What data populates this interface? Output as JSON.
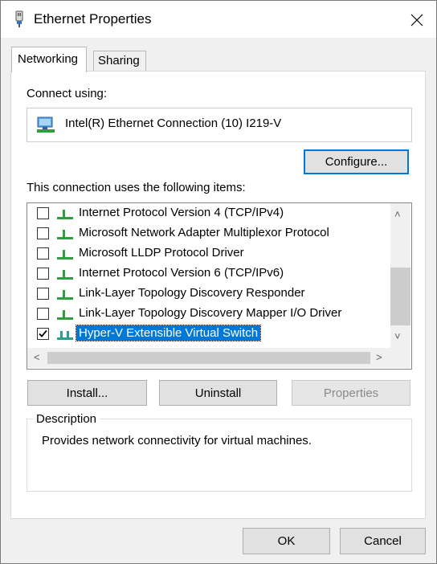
{
  "window": {
    "title": "Ethernet Properties"
  },
  "tabs": [
    {
      "label": "Networking",
      "active": true
    },
    {
      "label": "Sharing",
      "active": false
    }
  ],
  "connect_using": {
    "label": "Connect using:",
    "adapter_name": "Intel(R) Ethernet Connection (10) I219-V",
    "configure_label": "Configure..."
  },
  "items": {
    "heading": "This connection uses the following items:",
    "list": [
      {
        "label": "Internet Protocol Version 4 (TCP/IPv4)",
        "checked": false
      },
      {
        "label": "Microsoft Network Adapter Multiplexor Protocol",
        "checked": false
      },
      {
        "label": "Microsoft LLDP Protocol Driver",
        "checked": false
      },
      {
        "label": "Internet Protocol Version 6 (TCP/IPv6)",
        "checked": false
      },
      {
        "label": "Link-Layer Topology Discovery Responder",
        "checked": false
      },
      {
        "label": "Link-Layer Topology Discovery Mapper I/O Driver",
        "checked": false
      },
      {
        "label": "Hyper-V Extensible Virtual Switch",
        "checked": true,
        "selected": true
      }
    ]
  },
  "actions": {
    "install_label": "Install...",
    "uninstall_label": "Uninstall",
    "properties_label": "Properties"
  },
  "description": {
    "title": "Description",
    "text": "Provides network connectivity for virtual machines."
  },
  "footer": {
    "ok_label": "OK",
    "cancel_label": "Cancel"
  },
  "colors": {
    "accent": "#0078d7",
    "protocol_icon": "#2e9e3e"
  }
}
